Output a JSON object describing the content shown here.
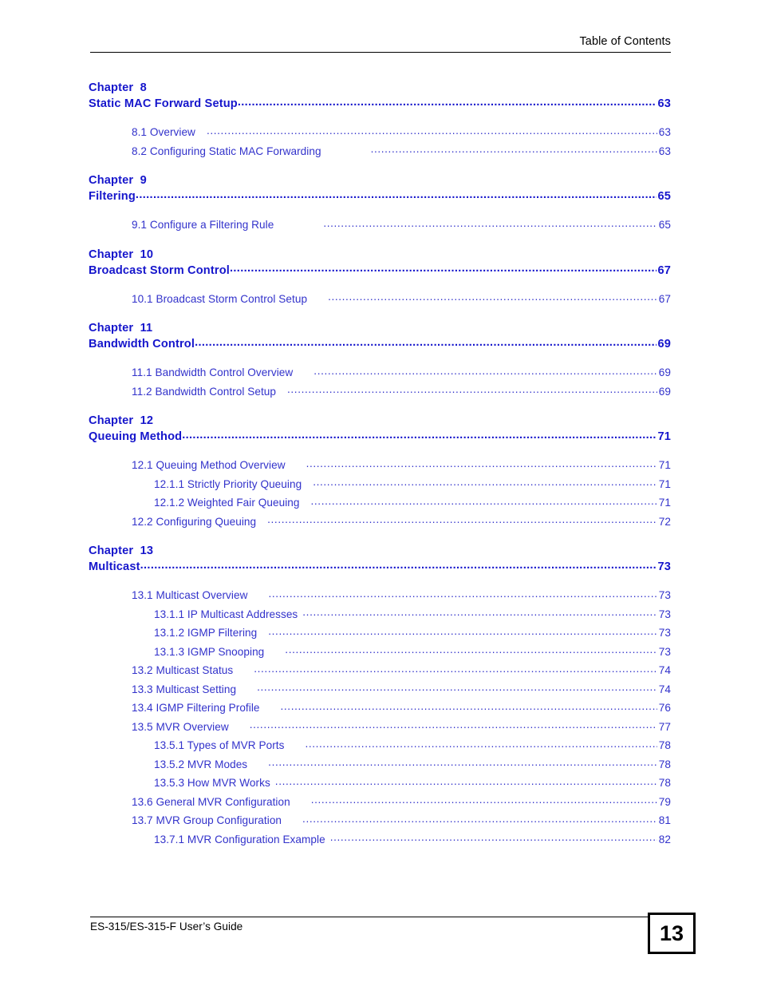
{
  "header": {
    "title": "Table of Contents"
  },
  "footer": {
    "guide_title": "ES-315/ES-315-F User’s Guide",
    "page_number": "13"
  },
  "colors": {
    "chapter_blue": "#1616cc",
    "entry_blue": "#3232cb",
    "rule_black": "#000000"
  },
  "toc": {
    "chapters": [
      {
        "label": "Chapter  8",
        "title": "Static MAC Forward Setup",
        "page": "63",
        "entries": [
          {
            "level": 1,
            "text": "8.1 Overview",
            "gap": "sm",
            "page": "63"
          },
          {
            "level": 1,
            "text": "8.2 Configuring Static MAC Forwarding",
            "gap": "lg",
            "page": "63"
          }
        ]
      },
      {
        "label": "Chapter  9",
        "title": "Filtering",
        "page": "65",
        "entries": [
          {
            "level": 1,
            "text": "9.1 Configure a Filtering Rule",
            "gap": "lg",
            "page": "65"
          }
        ]
      },
      {
        "label": "Chapter  10",
        "title": "Broadcast Storm Control",
        "page": "67",
        "entries": [
          {
            "level": 1,
            "text": "10.1 Broadcast Storm Control Setup",
            "gap": "md",
            "page": "67"
          }
        ]
      },
      {
        "label": "Chapter  11",
        "title": "Bandwidth Control",
        "page": "69",
        "entries": [
          {
            "level": 1,
            "text": "11.1 Bandwidth Control Overview",
            "gap": "md",
            "page": "69"
          },
          {
            "level": 1,
            "text": "11.2 Bandwidth Control Setup",
            "gap": "sm",
            "page": "69"
          }
        ]
      },
      {
        "label": "Chapter  12",
        "title": "Queuing Method",
        "page": "71",
        "entries": [
          {
            "level": 1,
            "text": "12.1 Queuing Method Overview",
            "gap": "md",
            "page": "71"
          },
          {
            "level": 2,
            "text": "12.1.1 Strictly Priority Queuing",
            "gap": "sm",
            "page": "71"
          },
          {
            "level": 2,
            "text": "12.1.2 Weighted Fair Queuing",
            "gap": "sm",
            "page": "71"
          },
          {
            "level": 1,
            "text": "12.2 Configuring Queuing",
            "gap": "sm",
            "page": "72"
          }
        ]
      },
      {
        "label": "Chapter  13",
        "title": "Multicast",
        "page": "73",
        "entries": [
          {
            "level": 1,
            "text": "13.1 Multicast Overview",
            "gap": "md",
            "page": "73"
          },
          {
            "level": 2,
            "text": "13.1.1 IP Multicast Addresses",
            "gap": "xs",
            "page": "73"
          },
          {
            "level": 2,
            "text": "13.1.2 IGMP Filtering",
            "gap": "sm",
            "page": "73"
          },
          {
            "level": 2,
            "text": "13.1.3 IGMP Snooping",
            "gap": "md",
            "page": "73"
          },
          {
            "level": 1,
            "text": "13.2 Multicast Status",
            "gap": "md",
            "page": "74"
          },
          {
            "level": 1,
            "text": "13.3 Multicast Setting",
            "gap": "md",
            "page": "74"
          },
          {
            "level": 1,
            "text": "13.4 IGMP Filtering Profile",
            "gap": "md",
            "page": "76"
          },
          {
            "level": 1,
            "text": "13.5 MVR Overview",
            "gap": "md",
            "page": "77"
          },
          {
            "level": 2,
            "text": "13.5.1 Types of MVR Ports",
            "gap": "md",
            "page": "78"
          },
          {
            "level": 2,
            "text": "13.5.2 MVR Modes",
            "gap": "md",
            "page": "78"
          },
          {
            "level": 2,
            "text": "13.5.3 How MVR Works",
            "gap": "xs",
            "page": "78"
          },
          {
            "level": 1,
            "text": "13.6 General MVR Configuration",
            "gap": "md",
            "page": "79"
          },
          {
            "level": 1,
            "text": "13.7 MVR Group Configuration",
            "gap": "md",
            "page": "81"
          },
          {
            "level": 2,
            "text": "13.7.1 MVR Configuration Example",
            "gap": "xs",
            "page": "82"
          }
        ]
      }
    ]
  }
}
